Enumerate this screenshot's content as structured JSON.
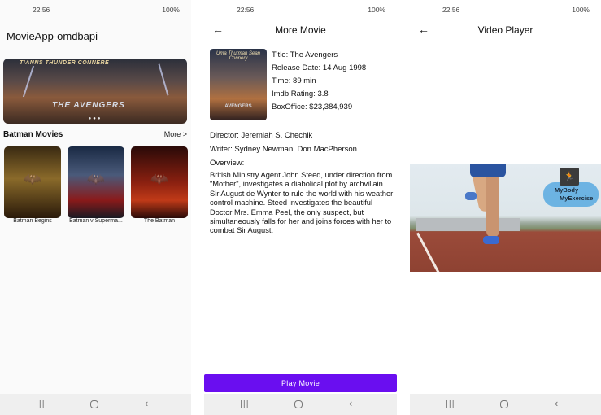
{
  "status_bar": {
    "time": "22:56",
    "battery": "100%"
  },
  "screen1": {
    "app_title": "MovieApp-omdbapi",
    "banner": {
      "caption": "TIANNS THUNDER CONNERE",
      "logo_text": "THE AVENGERS"
    },
    "section_title": "Batman Movies",
    "more_label": "More >",
    "movies": [
      {
        "title": "Batman Begins"
      },
      {
        "title": "Batman v Superma..."
      },
      {
        "title": "The Batman"
      }
    ]
  },
  "screen2": {
    "title": "More Movie",
    "poster": {
      "caption": "Uma Thurman Sean Connery",
      "logo_text": "AVENGERS"
    },
    "info": {
      "title": "Title: The Avengers",
      "release_date": "Release Date: 14 Aug 1998",
      "time": "Time: 89 min",
      "rating": "Imdb Rating: 3.8",
      "boxoffice": "BoxOffice: $23,384,939"
    },
    "director": "Director: Jeremiah S. Chechik",
    "writer": "Writer: Sydney Newman, Don MacPherson",
    "overview_label": "Overview:",
    "overview": "British Ministry Agent John Steed, under direction from \"Mother\", investigates a diabolical plot by archvillain Sir August de Wynter to rule the world with his weather control machine. Steed investigates the beautiful Doctor Mrs. Emma Peel, the only suspect, but simultaneously falls for her and joins forces with her to combat Sir August.",
    "play_button": "Play Movie"
  },
  "screen3": {
    "title": "Video Player",
    "watermark_line1": "MyBody",
    "watermark_line2": "MyExercise"
  },
  "icons": {
    "back": "arrow-left-icon",
    "nav_recents": "recents-icon",
    "nav_home": "home-icon",
    "nav_back": "chevron-left-icon"
  }
}
